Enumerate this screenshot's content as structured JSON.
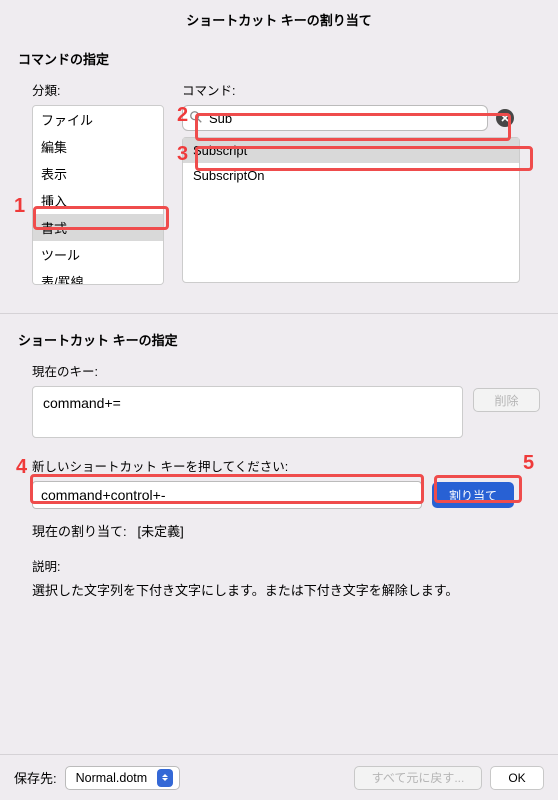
{
  "title": "ショートカット キーの割り当て",
  "section1": {
    "header": "コマンドの指定",
    "category_label": "分類:",
    "command_label": "コマンド:",
    "categories": [
      "ファイル",
      "編集",
      "表示",
      "挿入",
      "書式",
      "ツール",
      "表/罫線"
    ],
    "selected_category_index": 4,
    "search_value": "Sub",
    "commands": [
      "Subscript",
      "SubscriptOn"
    ],
    "selected_command_index": 0
  },
  "section2": {
    "header": "ショートカット キーの指定",
    "current_label": "現在のキー:",
    "current_key": "command+=",
    "delete_label": "削除",
    "newkey_label": "新しいショートカット キーを押してください:",
    "newkey_value": "command+control+-",
    "assign_label": "割り当て",
    "current_assign_label": "現在の割り当て:",
    "current_assign_value": "[未定義]",
    "desc_label": "説明:",
    "desc_text": "選択した文字列を下付き文字にします。または下付き文字を解除します。"
  },
  "footer": {
    "save_label": "保存先:",
    "save_value": "Normal.dotm",
    "reset_label": "すべて元に戻す...",
    "ok_label": "OK"
  },
  "annotations": {
    "n1": "1",
    "n2": "2",
    "n3": "3",
    "n4": "4",
    "n5": "5"
  }
}
